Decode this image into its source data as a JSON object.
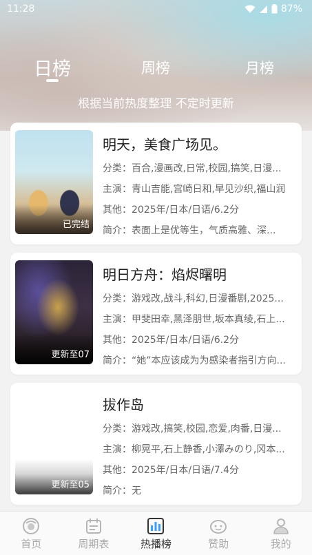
{
  "status_bar": {
    "time": "11:28",
    "battery": "87%",
    "icons": [
      "wifi-icon",
      "signal-icon",
      "battery-icon"
    ]
  },
  "tabs": [
    {
      "label": "日榜",
      "active": true
    },
    {
      "label": "周榜",
      "active": false
    },
    {
      "label": "月榜",
      "active": false
    }
  ],
  "subtitle": "根据当前热度整理 不定时更新",
  "cards": [
    {
      "title": "明天，美食广场见。",
      "badge": "已完结",
      "category": "分类：百合,漫画改,日常,校园,搞笑,日漫...",
      "cast": "主演：青山吉能,宫崎日和,早见沙织,福山润",
      "other": "其他：2025年/日本/日语/6.2分",
      "intro": "简介：表面上是优等生，气质高雅、深..."
    },
    {
      "title": "明日方舟：焰烬曙明",
      "badge": "更新至07",
      "category": "分类：游戏改,战斗,科幻,日漫番剧,2025...",
      "cast": "主演：甲斐田幸,黑泽朋世,坂本真绫,石上...",
      "other": "其他：2025年/日本/日语/6.2分",
      "intro": "简介：“她”本应该成为为感染者指引方向..."
    },
    {
      "title": "拔作岛",
      "badge": "更新至05",
      "category": "分类：游戏改,搞笑,校园,恋爱,肉番,日漫...",
      "cast": "主演：柳晃平,石上静香,小澤みのり,冈本...",
      "other": "其他：2025年/日本/日语/7.4分",
      "intro": "简介：无"
    }
  ],
  "bottom_nav": [
    {
      "label": "首页",
      "icon": "home-icon",
      "active": false
    },
    {
      "label": "周期表",
      "icon": "calendar-icon",
      "active": false
    },
    {
      "label": "热播榜",
      "icon": "chart-icon",
      "active": true
    },
    {
      "label": "赞助",
      "icon": "sponsor-icon",
      "active": false
    },
    {
      "label": "我的",
      "icon": "profile-icon",
      "active": false
    }
  ],
  "colors": {
    "active_nav": "#333333",
    "inactive_nav": "#aaaaaa",
    "chart_icon_accent": "#3aa0ff"
  }
}
